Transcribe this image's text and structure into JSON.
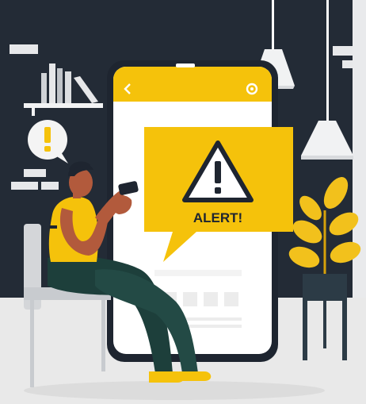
{
  "alert": {
    "label": "ALERT!"
  },
  "icons": {
    "warning": "warning-triangle-icon",
    "exclamation_bubble": "exclamation-icon",
    "back": "back-arrow-icon",
    "settings": "gear-icon"
  },
  "colors": {
    "wall": "#232b36",
    "accent_yellow": "#f5c20b",
    "phone_screen": "#ffffff",
    "floor": "#e8e8e8",
    "plant_leaf": "#f2c11c",
    "pants": "#1d3f3b",
    "skin": "#b25a3c"
  }
}
